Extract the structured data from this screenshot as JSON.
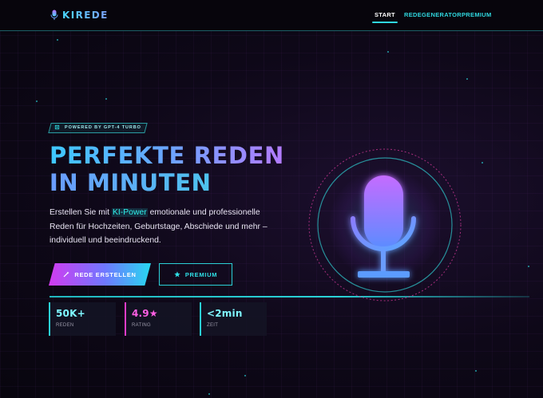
{
  "header": {
    "brand": "KIREDE",
    "nav": [
      {
        "label": "START",
        "active": true
      },
      {
        "label": "REDEGENERATOR",
        "active": false
      },
      {
        "label": "PREMIUM",
        "active": false
      }
    ]
  },
  "hero": {
    "badge": "POWERED BY GPT-4 TURBO",
    "title_line1": "PERFEKTE REDEN",
    "title_line2": "IN MINUTEN",
    "desc_before": "Erstellen Sie mit ",
    "desc_highlight": "KI-Power",
    "desc_after": " emotionale und professionelle Reden für Hochzeiten, Geburtstage, Abschiede und mehr – individuell und beeindruckend.",
    "primary_button": "REDE ERSTELLEN",
    "secondary_button": "PREMIUM"
  },
  "stats": [
    {
      "value": "50K+",
      "label": "REDEN"
    },
    {
      "value": "4.9★",
      "label": "RATING"
    },
    {
      "value": "<2min",
      "label": "ZEIT"
    }
  ],
  "icons": {
    "brand": "microphone-icon",
    "badge": "chip-icon",
    "primary_button": "wand-icon",
    "secondary_button": "star-icon",
    "hero_graphic": "microphone-icon"
  },
  "colors": {
    "background": "#0a0612",
    "accent_cyan": "#2fd8df",
    "accent_pink": "#e03cc8",
    "accent_purple": "#b37bff"
  }
}
